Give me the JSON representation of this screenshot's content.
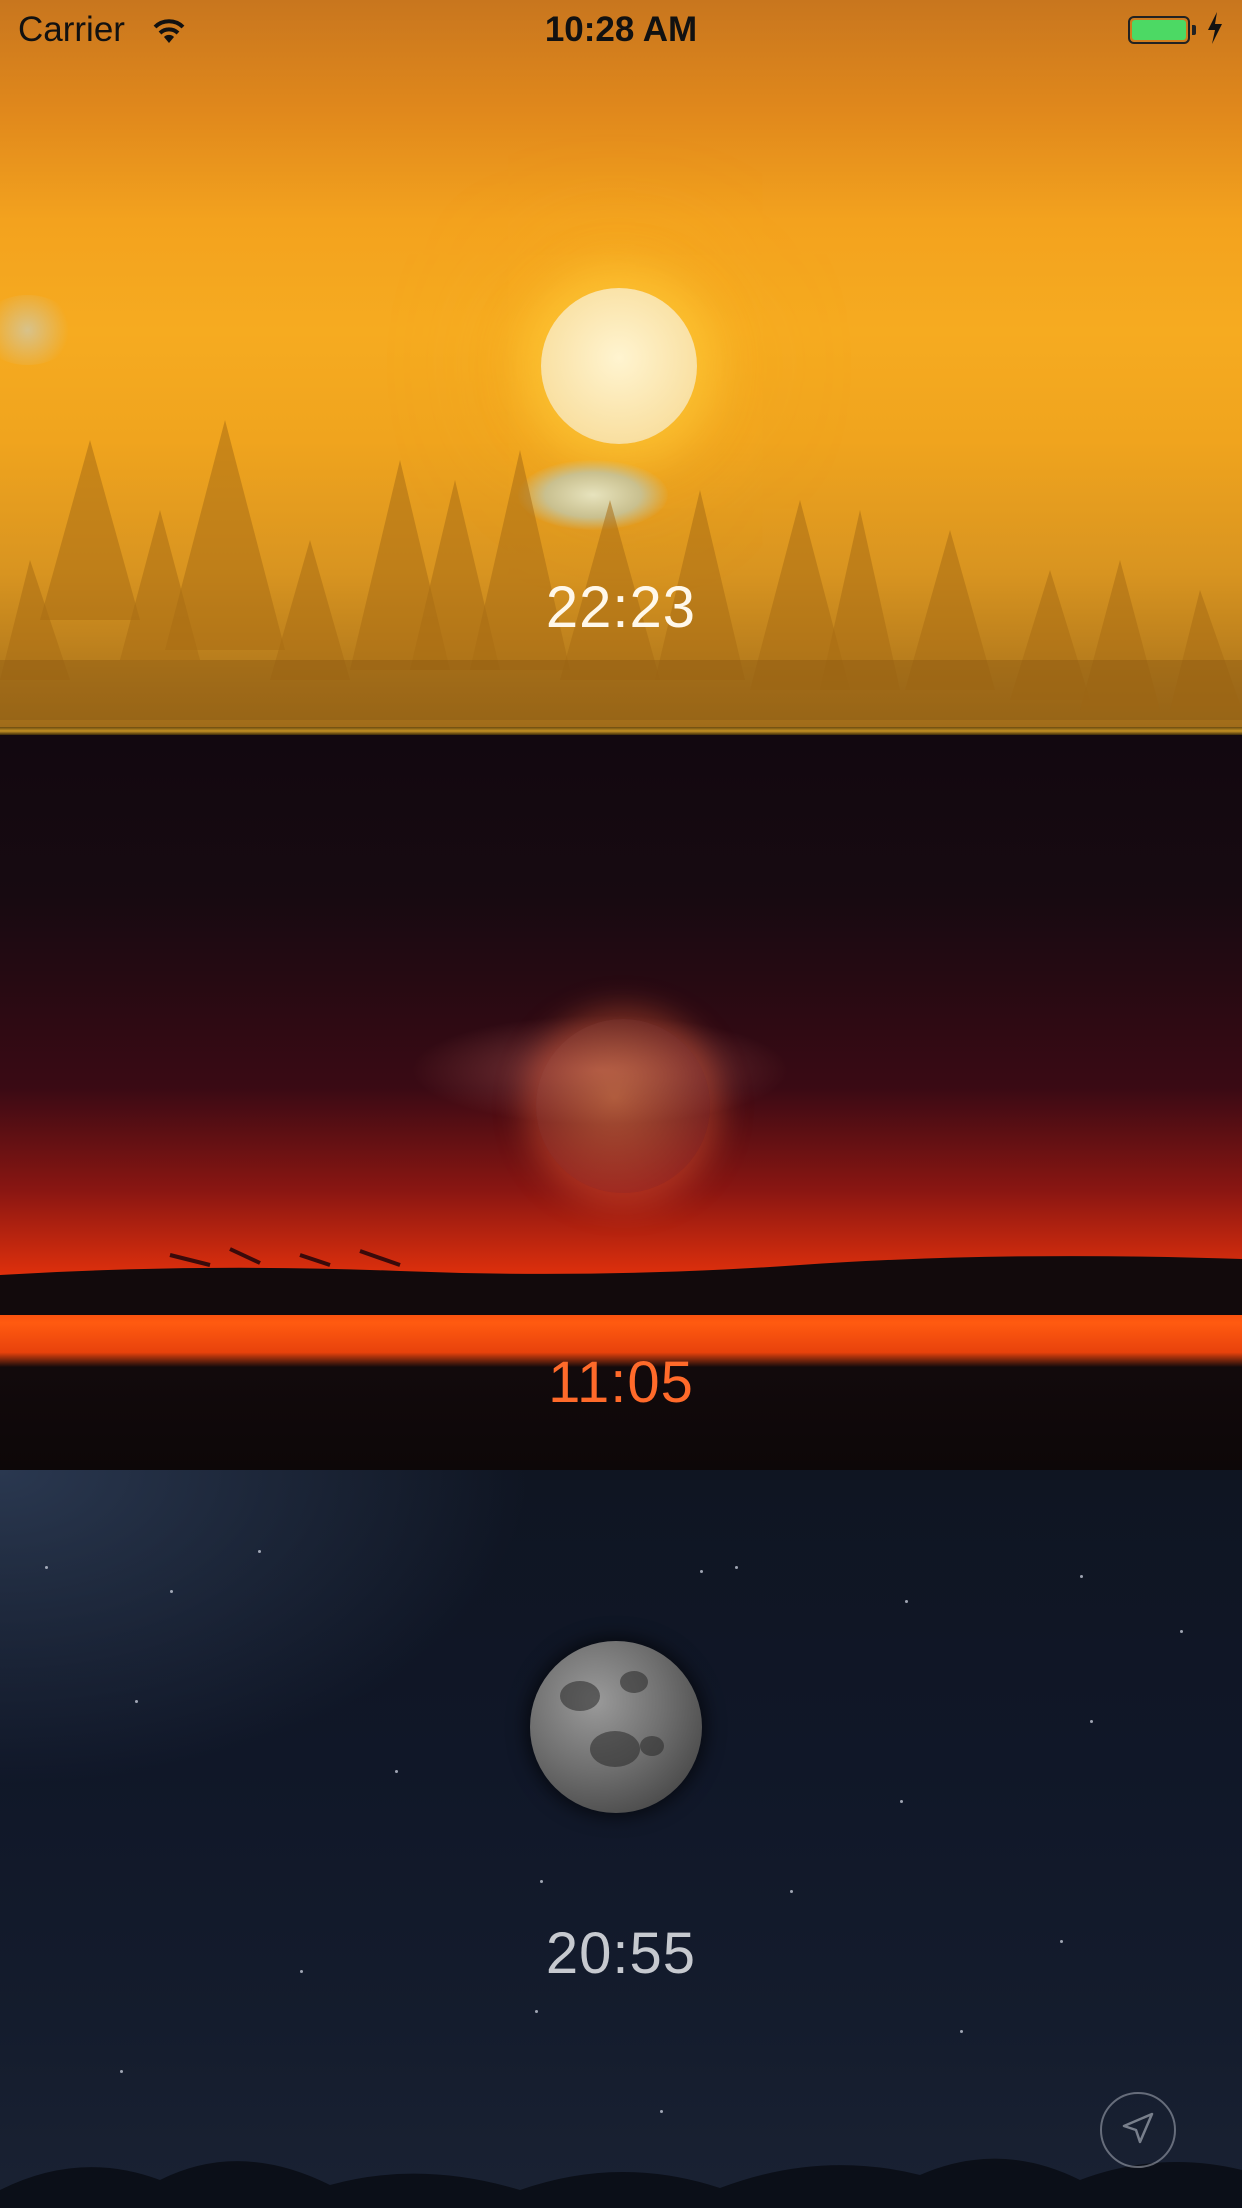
{
  "status_bar": {
    "carrier": "Carrier",
    "clock": "10:28 AM",
    "battery_color": "#4cd964"
  },
  "panels": [
    {
      "name": "sunrise",
      "time": "22:23",
      "time_color": "#fff8ea",
      "icon": "sun-icon"
    },
    {
      "name": "sunset",
      "time": "11:05",
      "time_color": "#ff6a2a",
      "icon": "moon-icon"
    },
    {
      "name": "night",
      "time": "20:55",
      "time_color": "#c6c9cf",
      "icon": "moon-icon"
    }
  ],
  "location_button": {
    "icon": "location-arrow-icon"
  }
}
